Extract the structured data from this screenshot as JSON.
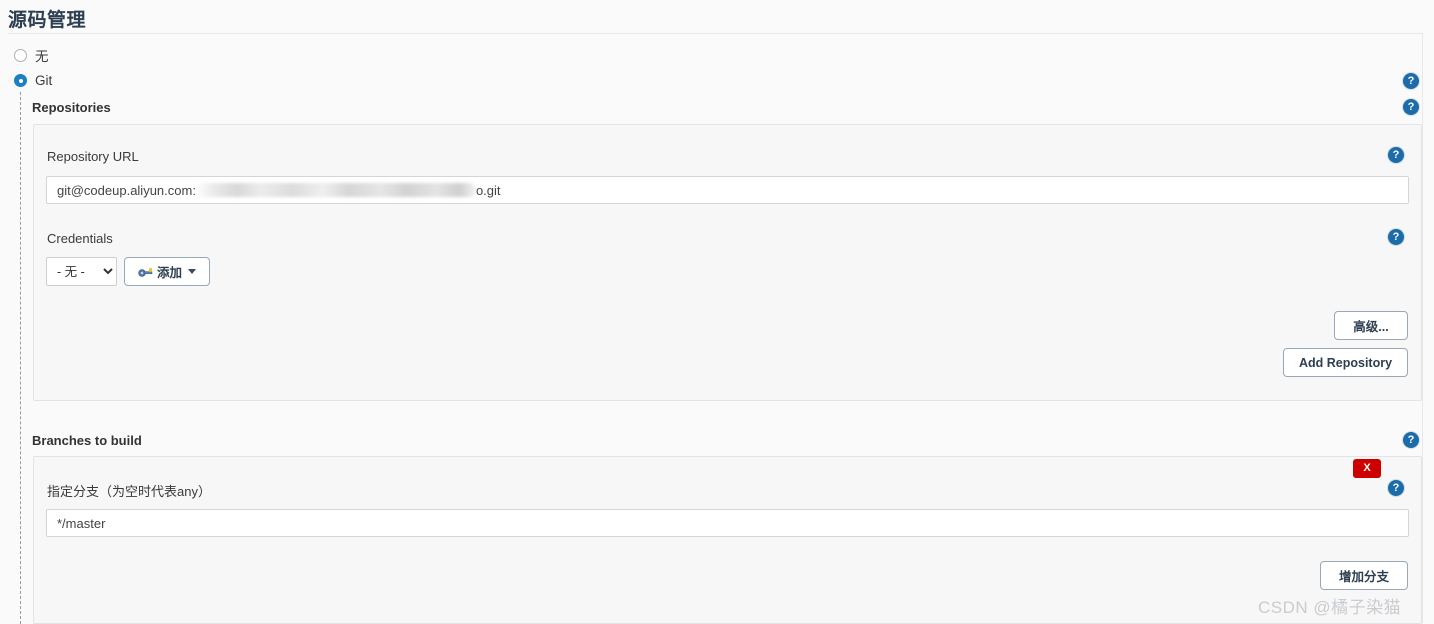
{
  "header": {
    "title": "源码管理"
  },
  "scm_options": [
    {
      "label": "无",
      "selected": false,
      "name": "none"
    },
    {
      "label": "Git",
      "selected": true,
      "name": "git"
    }
  ],
  "repositories": {
    "section_label": "Repositories",
    "repository_url": {
      "label": "Repository URL",
      "value_prefix": "git@codeup.aliyun.com:",
      "value_suffix": "o.git",
      "redacted": true
    },
    "credentials": {
      "label": "Credentials",
      "selected_option": "- 无 -",
      "options": [
        "- 无 -"
      ],
      "add_button": "添加"
    },
    "advanced_button": "高级...",
    "add_repository_button": "Add Repository"
  },
  "branches": {
    "section_label": "Branches to build",
    "branch_specifier": {
      "label": "指定分支（为空时代表any）",
      "value": "*/master"
    },
    "delete_button": "X",
    "add_branch_button": "增加分支"
  },
  "icons": {
    "help": "?",
    "key": "key-icon",
    "caret": "chevron-down-icon"
  },
  "watermark": "CSDN @橘子染猫",
  "colors": {
    "accent": "#1b6ca8",
    "danger": "#cc0000",
    "radio_selected": "#1b7fc4",
    "panel_bg": "#f7f7f7",
    "page_bg": "#fafafa"
  }
}
